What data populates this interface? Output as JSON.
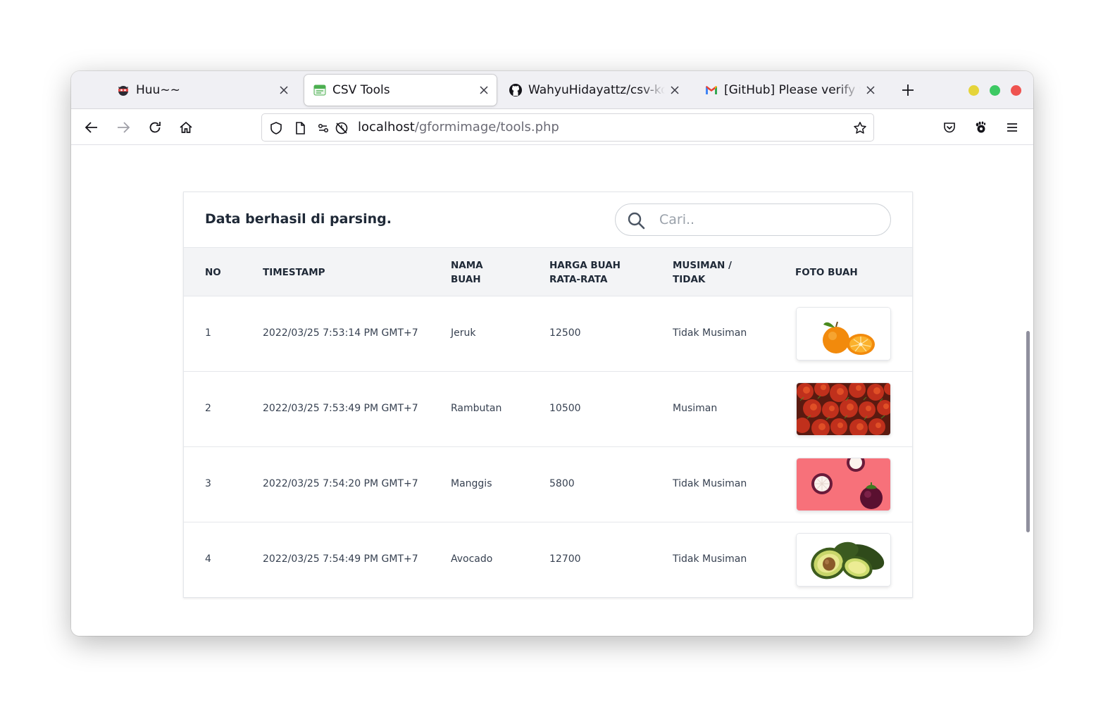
{
  "browser": {
    "tabs": [
      {
        "title": "Huu~~",
        "favicon": "ninja-favicon",
        "active": false
      },
      {
        "title": "CSV Tools",
        "favicon": "csv-favicon",
        "active": true
      },
      {
        "title": "WahyuHidayattz/csv-konv",
        "favicon": "github-favicon",
        "active": false
      },
      {
        "title": "[GitHub] Please verify you",
        "favicon": "gmail-favicon",
        "active": false
      }
    ],
    "url_host": "localhost",
    "url_path": "/gformimage/tools.php",
    "window_controls": [
      "#e5d43a",
      "#3dc963",
      "#ef5350"
    ]
  },
  "page": {
    "title": "Data berhasil di parsing.",
    "search_placeholder": "Cari..",
    "columns": [
      {
        "line1": "NO",
        "line2": ""
      },
      {
        "line1": "TIMESTAMP",
        "line2": ""
      },
      {
        "line1": "NAMA",
        "line2": "BUAH"
      },
      {
        "line1": "HARGA BUAH",
        "line2": "RATA-RATA"
      },
      {
        "line1": "MUSIMAN /",
        "line2": "TIDAK"
      },
      {
        "line1": "FOTO BUAH",
        "line2": ""
      }
    ],
    "rows": [
      {
        "no": "1",
        "timestamp": "2022/03/25 7:53:14 PM GMT+7",
        "nama": "Jeruk",
        "harga": "12500",
        "musiman": "Tidak Musiman",
        "foto": "orange-photo"
      },
      {
        "no": "2",
        "timestamp": "2022/03/25 7:53:49 PM GMT+7",
        "nama": "Rambutan",
        "harga": "10500",
        "musiman": "Musiman",
        "foto": "rambutan-photo"
      },
      {
        "no": "3",
        "timestamp": "2022/03/25 7:54:20 PM GMT+7",
        "nama": "Manggis",
        "harga": "5800",
        "musiman": "Tidak Musiman",
        "foto": "mangosteen-photo"
      },
      {
        "no": "4",
        "timestamp": "2022/03/25 7:54:49 PM GMT+7",
        "nama": "Avocado",
        "harga": "12700",
        "musiman": "Tidak Musiman",
        "foto": "avocado-photo"
      }
    ]
  }
}
